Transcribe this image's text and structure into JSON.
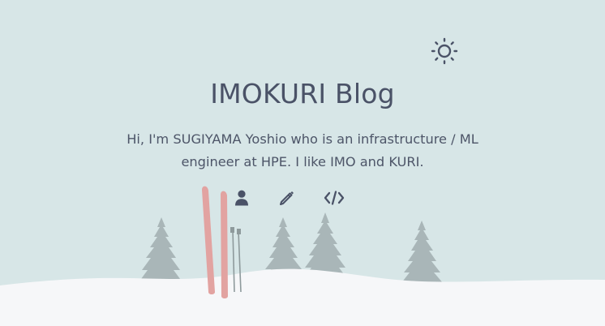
{
  "header": {
    "theme_toggle_icon": "sun-icon"
  },
  "hero": {
    "title": "IMOKURI Blog",
    "description": "Hi, I'm SUGIYAMA Yoshio who is an infrastructure / ML engineer at HPE. I like IMO and KURI."
  },
  "social": {
    "items": [
      {
        "icon": "person-icon"
      },
      {
        "icon": "pencil-icon"
      },
      {
        "icon": "code-icon"
      }
    ]
  },
  "colors": {
    "background": "#d7e6e7",
    "text": "#4a5267",
    "trees": "#a9b6b8",
    "snow": "#f6f7f9",
    "skis": "#e2a3a1"
  }
}
